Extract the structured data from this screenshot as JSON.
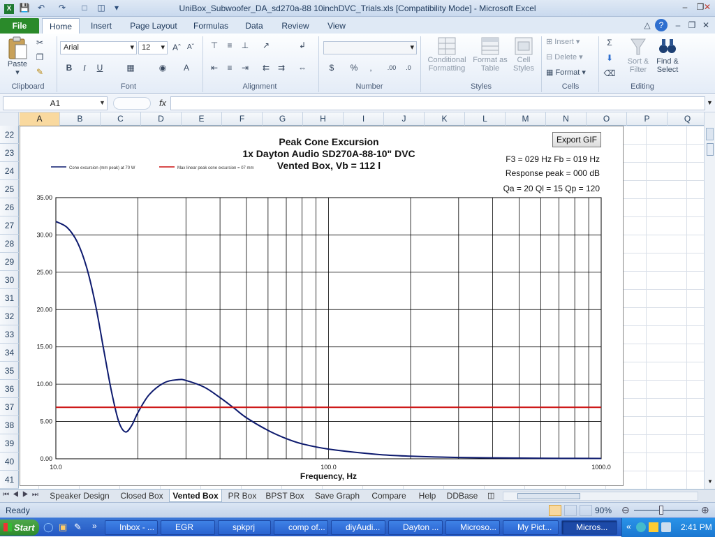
{
  "window": {
    "title": "UniBox_Subwoofer_DA_sd270a-88 10inchDVC_Trials.xls  [Compatibility Mode]  -  Microsoft Excel"
  },
  "ribbon_tabs": [
    "File",
    "Home",
    "Insert",
    "Page Layout",
    "Formulas",
    "Data",
    "Review",
    "View"
  ],
  "ribbon": {
    "paste": "Paste",
    "font_name": "Arial",
    "font_size": "12",
    "groups": [
      "Clipboard",
      "Font",
      "Alignment",
      "Number",
      "Styles",
      "Cells",
      "Editing"
    ],
    "styles": [
      "Conditional Formatting",
      "Format as Table",
      "Cell Styles"
    ],
    "cells": [
      "Insert",
      "Delete",
      "Format"
    ],
    "editing": [
      "Sort & Filter",
      "Find & Select"
    ]
  },
  "formula_bar": {
    "name_box": "A1",
    "fx": "fx",
    "value": ""
  },
  "columns": [
    "A",
    "B",
    "C",
    "D",
    "E",
    "F",
    "G",
    "H",
    "I",
    "J",
    "K",
    "L",
    "M",
    "N",
    "O",
    "P",
    "Q"
  ],
  "rows": [
    "22",
    "23",
    "24",
    "25",
    "26",
    "27",
    "28",
    "29",
    "30",
    "31",
    "32",
    "33",
    "34",
    "35",
    "36",
    "37",
    "38",
    "39",
    "40",
    "41"
  ],
  "chart_panel": {
    "export_button": "Export GIF",
    "title_lines": [
      "Peak Cone Excursion",
      "1x Dayton Audio SD270A-88-10\" DVC",
      "Vented Box, Vb = 112 l"
    ],
    "info": {
      "line1": "F3 = 029 Hz  Fb = 019 Hz",
      "line2": "Response peak = 000 dB",
      "line3": "Qa = 20  Ql = 15  Qp = 120"
    }
  },
  "chart_data": {
    "type": "line",
    "title": "Peak Cone Excursion",
    "xlabel": "Frequency, Hz",
    "ylabel": "",
    "xscale": "log",
    "xlim": [
      10,
      1000
    ],
    "ylim": [
      0,
      35
    ],
    "x_ticks": [
      "10.0",
      "100.0",
      "1000.0"
    ],
    "y_ticks": [
      "0.00",
      "5.00",
      "10.00",
      "15.00",
      "20.00",
      "25.00",
      "30.00",
      "35.00"
    ],
    "grid": true,
    "legend_placement": "top-left",
    "series": [
      {
        "name": "Cone excursion (mm peak) at 70 W",
        "color": "#0d1a6e",
        "x": [
          10,
          11,
          12,
          13,
          14,
          15,
          16,
          17,
          18,
          19,
          20,
          22,
          25,
          28,
          30,
          35,
          40,
          45,
          50,
          60,
          70,
          80,
          100,
          150,
          200,
          300,
          500,
          700,
          1000
        ],
        "y": [
          31.8,
          31.0,
          29.0,
          25.5,
          20.5,
          14.5,
          9.0,
          5.0,
          3.6,
          4.5,
          6.2,
          8.6,
          10.2,
          10.6,
          10.5,
          9.6,
          8.2,
          6.8,
          5.5,
          3.8,
          2.7,
          2.0,
          1.3,
          0.6,
          0.35,
          0.18,
          0.09,
          0.06,
          0.05
        ]
      },
      {
        "name": "Max linear peak cone excursion = 07 mm",
        "color": "#cc1111",
        "x": [
          10,
          1000
        ],
        "y": [
          6.9,
          6.9
        ]
      }
    ]
  },
  "sheet_tabs": [
    "Speaker Design",
    "Closed Box",
    "Vented Box",
    "PR Box",
    "BPST Box",
    "Save Graph",
    "Compare",
    "Help",
    "DDBase"
  ],
  "active_sheet": "Vented Box",
  "status": {
    "ready": "Ready",
    "zoom": "90%"
  },
  "taskbar": {
    "start": "Start",
    "items": [
      "Inbox - ...",
      "EGR",
      "spkprj",
      "comp of...",
      "diyAudi...",
      "Dayton ...",
      "Microso...",
      "My Pict...",
      "Micros..."
    ],
    "active_item": "Micros...",
    "clock": "2:41 PM"
  }
}
